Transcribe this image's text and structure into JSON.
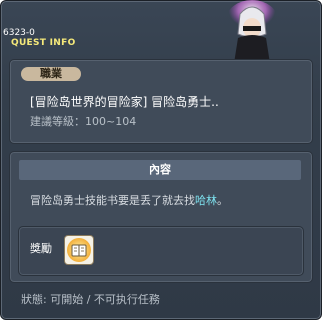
{
  "quest": {
    "id": "6323-0",
    "window_title": "QUEST INFO",
    "job_tag": "職業",
    "title": "[冒险岛世界的冒险家] 冒险岛勇士..",
    "level_label": "建議等級：100~104",
    "content_header": "內容",
    "content_text": "冒险岛勇士技能书要是丢了就去找",
    "npc_name": "哈林",
    "content_end": "。",
    "reward_label": "獎勵",
    "reward_icon": "skill-book-icon",
    "status": "狀態: 可開始 / 不可执行任務"
  },
  "colors": {
    "window_bg": "#333e4b",
    "panel_bg": "#404b59",
    "title_yellow": "#f5e97a",
    "npc_cyan": "#7ee3f0",
    "tag_tan": "#c9b89e"
  }
}
